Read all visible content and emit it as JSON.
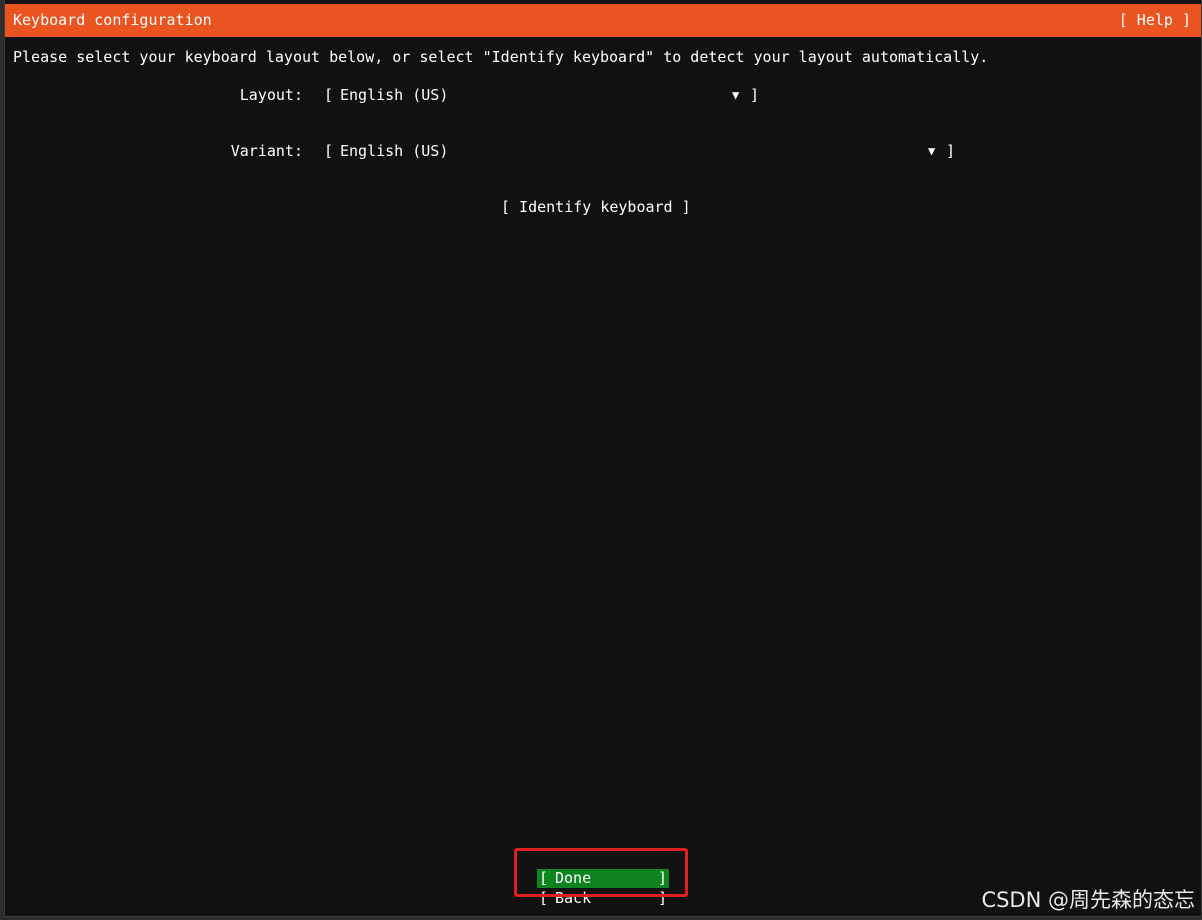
{
  "header": {
    "title": "Keyboard configuration",
    "help_label": "[ Help ]"
  },
  "instructions": "Please select your keyboard layout below, or select \"Identify keyboard\" to detect your layout automatically.",
  "form": {
    "layout": {
      "label": "Layout:",
      "value": "English (US)",
      "arrow_icon": "▼"
    },
    "variant": {
      "label": "Variant:",
      "value": "English (US)",
      "arrow_icon": "▼"
    },
    "identify_label": "[ Identify keyboard ]"
  },
  "buttons": {
    "done_label": "Done",
    "back_label": "Back"
  },
  "watermark": "CSDN @周先森的态忘",
  "colors": {
    "accent": "#e95420",
    "selected_button": "#0e8420",
    "background": "#111111",
    "annotation_box": "#e02020"
  }
}
